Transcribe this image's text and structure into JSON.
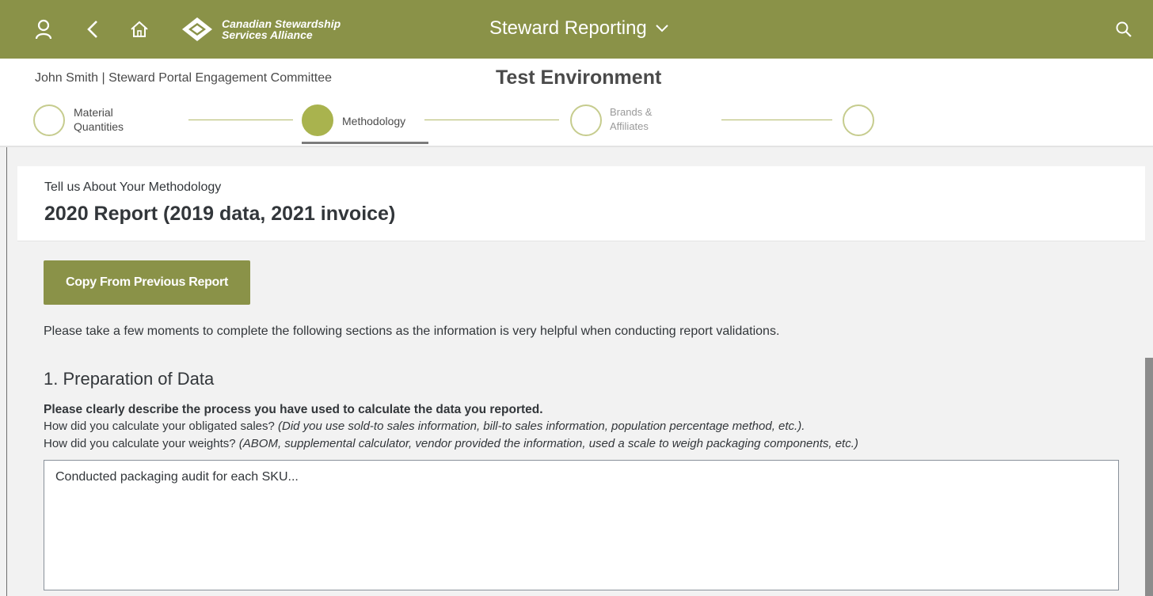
{
  "shell": {
    "logo_line1": "Canadian Stewardship",
    "logo_line2": "Services Alliance",
    "app_title": "Steward Reporting",
    "accent_color": "#8a9248"
  },
  "header": {
    "user_line": "John Smith | Steward Portal Engagement Committee",
    "environment": "Test Environment"
  },
  "wizard": {
    "steps": [
      {
        "line1": "Material",
        "line2": "Quantities",
        "state": "done"
      },
      {
        "line1": "Methodology",
        "line2": "",
        "state": "active"
      },
      {
        "line1": "Brands &",
        "line2": "Affiliates",
        "state": "upcoming"
      },
      {
        "line1": "",
        "line2": "",
        "state": "upcoming"
      }
    ]
  },
  "page": {
    "subtitle": "Tell us About Your Methodology",
    "title": "2020 Report (2019 data, 2021 invoice)",
    "copy_button": "Copy From Previous Report",
    "intro": "Please take a few moments to complete the following sections as the information is very helpful when conducting report validations.",
    "section1": {
      "heading": "1. Preparation of Data",
      "bold_question": "Please clearly describe the process you have used to calculate the data you reported.",
      "q1_text": "How did you calculate your obligated sales? ",
      "q1_hint": "(Did you use sold-to sales information, bill-to sales information, population percentage method, etc.).",
      "q2_text": "How did you calculate your weights? ",
      "q2_hint": "(ABOM, supplemental calculator, vendor provided the information, used a scale to weigh packaging components, etc.)",
      "answer": "Conducted packaging audit for each SKU..."
    }
  }
}
